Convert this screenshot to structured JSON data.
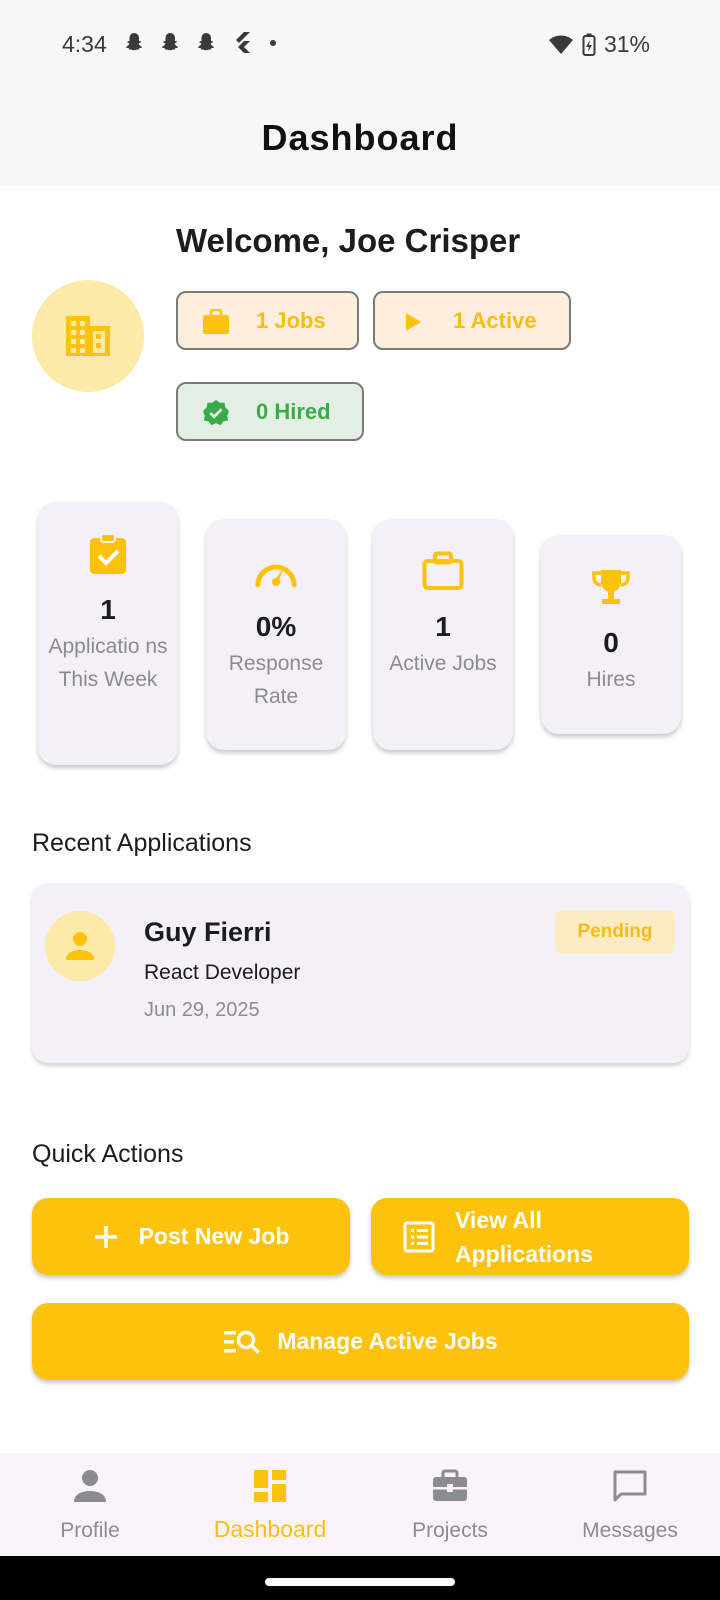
{
  "status_bar": {
    "time": "4:34",
    "battery": "31%"
  },
  "app_bar": {
    "title": "Dashboard"
  },
  "profile": {
    "welcome": "Welcome, Joe Crisper",
    "chips": {
      "jobs": "1 Jobs",
      "active": "1 Active",
      "hired": "0 Hired"
    }
  },
  "stats": [
    {
      "value": "1",
      "label": "Applicatio ns This Week"
    },
    {
      "value": "0%",
      "label": "Response Rate"
    },
    {
      "value": "1",
      "label": "Active Jobs"
    },
    {
      "value": "0",
      "label": "Hires"
    }
  ],
  "recent": {
    "title": "Recent Applications",
    "items": [
      {
        "name": "Guy Fierri",
        "role": "React Developer",
        "date": "Jun 29, 2025",
        "status": "Pending"
      }
    ]
  },
  "quick_actions": {
    "title": "Quick Actions",
    "post_job": "Post New Job",
    "view_all": "View All Applications",
    "manage": "Manage Active Jobs"
  },
  "nav": {
    "profile": "Profile",
    "dashboard": "Dashboard",
    "projects": "Projects",
    "messages": "Messages"
  },
  "colors": {
    "accent": "#fdc20e",
    "accent_text": "#f6bd13",
    "success": "#3aaa4a",
    "card_bg": "#f4f0f7"
  }
}
